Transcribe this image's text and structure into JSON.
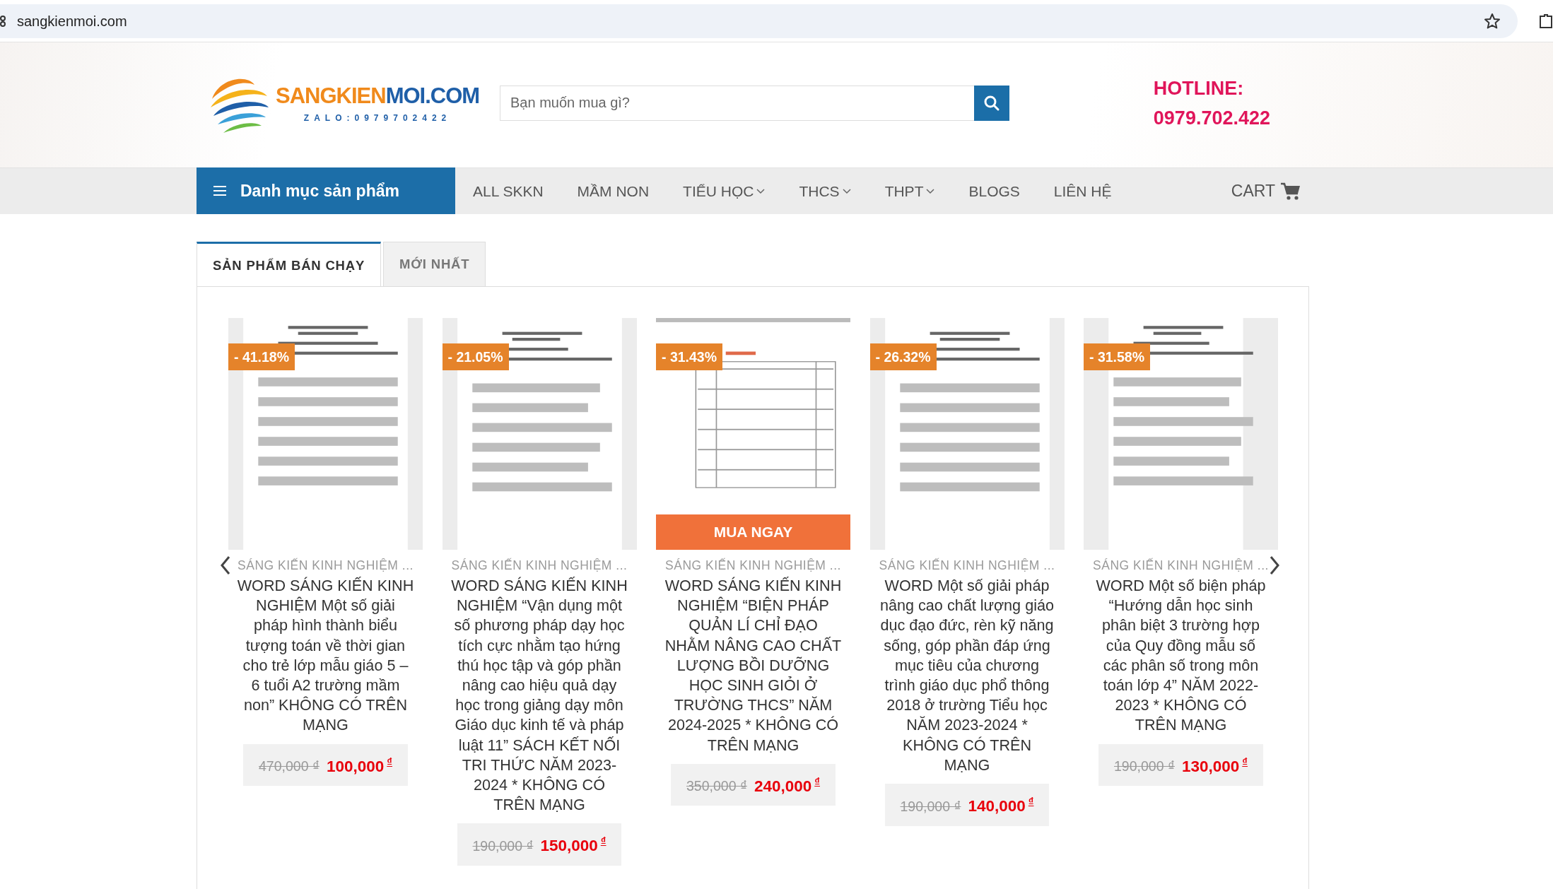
{
  "browser": {
    "url": "sangkienmoi.com"
  },
  "header": {
    "logo": {
      "brand_a": "SANGKIEN",
      "brand_b": "MOI.COM",
      "tagline": "ZALO:0979702422"
    },
    "search": {
      "placeholder": "Bạn muốn mua gì?"
    },
    "hotline": {
      "label": "HOTLINE:",
      "number": "0979.702.422"
    }
  },
  "nav": {
    "menu_button": "Danh mục sản phẩm",
    "items": [
      {
        "label": "ALL SKKN",
        "dropdown": false
      },
      {
        "label": "MẦM NON",
        "dropdown": false
      },
      {
        "label": "TIỂU HỌC",
        "dropdown": true
      },
      {
        "label": "THCS",
        "dropdown": true
      },
      {
        "label": "THPT",
        "dropdown": true
      },
      {
        "label": "BLOGS",
        "dropdown": false
      },
      {
        "label": "LIÊN HỆ",
        "dropdown": false
      }
    ],
    "cart": "CART"
  },
  "tabs": [
    {
      "label": "SẢN PHẨM BÁN CHẠY",
      "selected": true
    },
    {
      "label": "MỚI NHẤT",
      "selected": false
    }
  ],
  "products": [
    {
      "discount": "- 41.18%",
      "category": "SÁNG KIẾN KINH NGHIỆM ...",
      "title": "WORD SÁNG KIẾN KINH NGHIỆM Một số giải pháp hình thành biểu tượng toán về thời gian cho trẻ lớp mẫu giáo 5 – 6 tuổi A2 trường mầm non” KHÔNG CÓ TRÊN MẠNG",
      "old_price": "470,000 ₫",
      "price": "100,000",
      "currency": "₫"
    },
    {
      "discount": "- 21.05%",
      "category": "SÁNG KIẾN KINH NGHIỆM ...",
      "title": "WORD SÁNG KIẾN KINH NGHIỆM “Vận dụng một số phương pháp dạy học tích cực nhằm tạo hứng thú học tập và góp phần nâng cao hiệu quả dạy học trong giảng dạy môn Giáo dục kinh tế và pháp luật 11” SÁCH KẾT NỐI TRI THỨC NĂM 2023-2024 * KHÔNG CÓ TRÊN MẠNG",
      "old_price": "190,000 ₫",
      "price": "150,000",
      "currency": "₫"
    },
    {
      "discount": "- 31.43%",
      "buy_button": "MUA NGAY",
      "category": "SÁNG KIẾN KINH NGHIỆM ...",
      "title": "WORD SÁNG KIẾN KINH NGHIỆM “BIỆN PHÁP QUẢN LÍ CHỈ ĐẠO NHẰM NÂNG CAO CHẤT LƯỢNG BỒI DƯỠNG HỌC SINH GIỎI Ở TRƯỜNG THCS” NĂM 2024-2025 * KHÔNG CÓ TRÊN MẠNG",
      "old_price": "350,000 ₫",
      "price": "240,000",
      "currency": "₫"
    },
    {
      "discount": "- 26.32%",
      "category": "SÁNG KIẾN KINH NGHIỆM ...",
      "title": "WORD Một số giải pháp nâng cao chất lượng giáo dục đạo đức, rèn kỹ năng sống, góp phần đáp ứng mục tiêu của chương trình giáo dục phổ thông 2018 ở trường Tiểu học NĂM 2023-2024 * KHÔNG CÓ TRÊN MẠNG",
      "old_price": "190,000 ₫",
      "price": "140,000",
      "currency": "₫"
    },
    {
      "discount": "- 31.58%",
      "category": "SÁNG KIẾN KINH NGHIỆM ...",
      "title": "WORD Một số biện pháp “Hướng dẫn học sinh phân biệt 3 trường hợp của Quy đồng mẫu số các phân số trong môn toán lớp 4” NĂM 2022-2023 * KHÔNG CÓ TRÊN MẠNG",
      "old_price": "190,000 ₫",
      "price": "130,000",
      "currency": "₫"
    }
  ]
}
